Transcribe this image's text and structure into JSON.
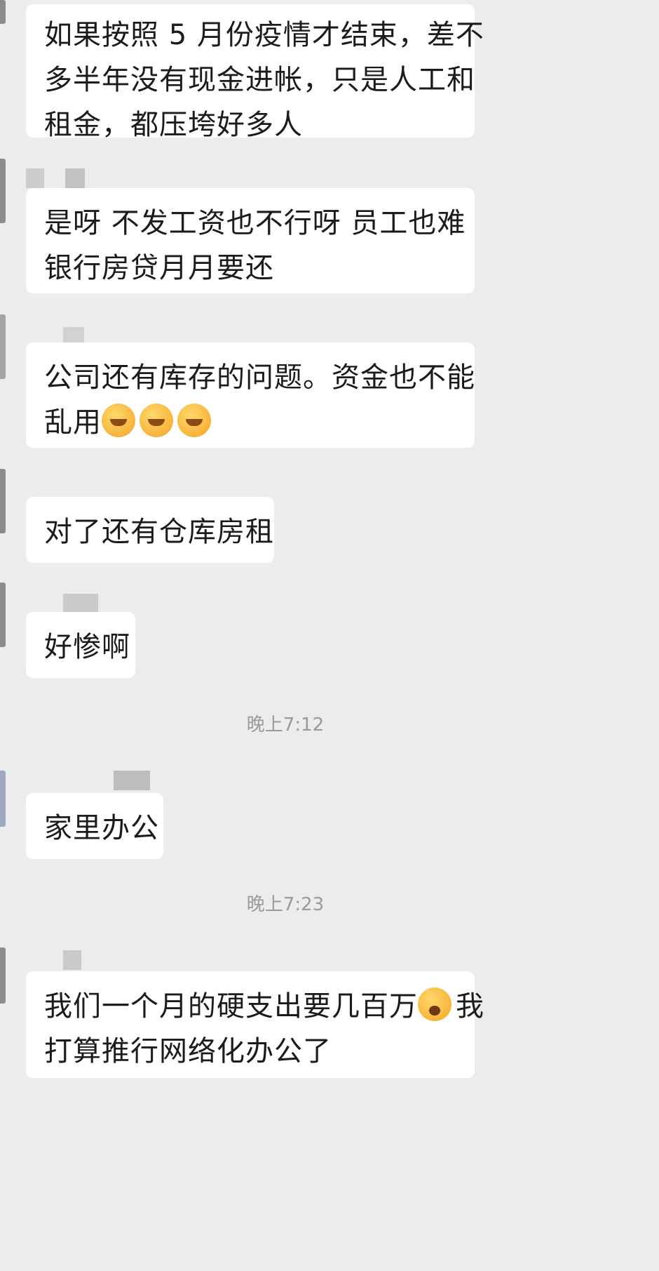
{
  "messages": [
    {
      "lines": [
        "如果按照 5 月份疫情才结束，差不",
        "多半年没有现金进帐，只是人工和",
        "租金，都压垮好多人"
      ]
    },
    {
      "lines": [
        "是呀 不发工资也不行呀 员工也难",
        "银行房贷月月要还"
      ]
    },
    {
      "lines": [
        "公司还有库存的问题。资金也不能",
        "乱用"
      ],
      "emoji_count": 3,
      "emoji_name": "crying-laughing-emoji"
    },
    {
      "lines": [
        "对了还有仓库房租"
      ]
    },
    {
      "lines": [
        "好惨啊"
      ]
    },
    {
      "lines": [
        "家里办公"
      ]
    },
    {
      "lines": [
        "我们一个月的硬支出要几百万",
        "打算推行网络化办公了"
      ],
      "inline_emoji_name": "screaming-emoji",
      "after_emoji": "我"
    }
  ],
  "timestamps": [
    "晚上7:12",
    "晚上7:23"
  ]
}
